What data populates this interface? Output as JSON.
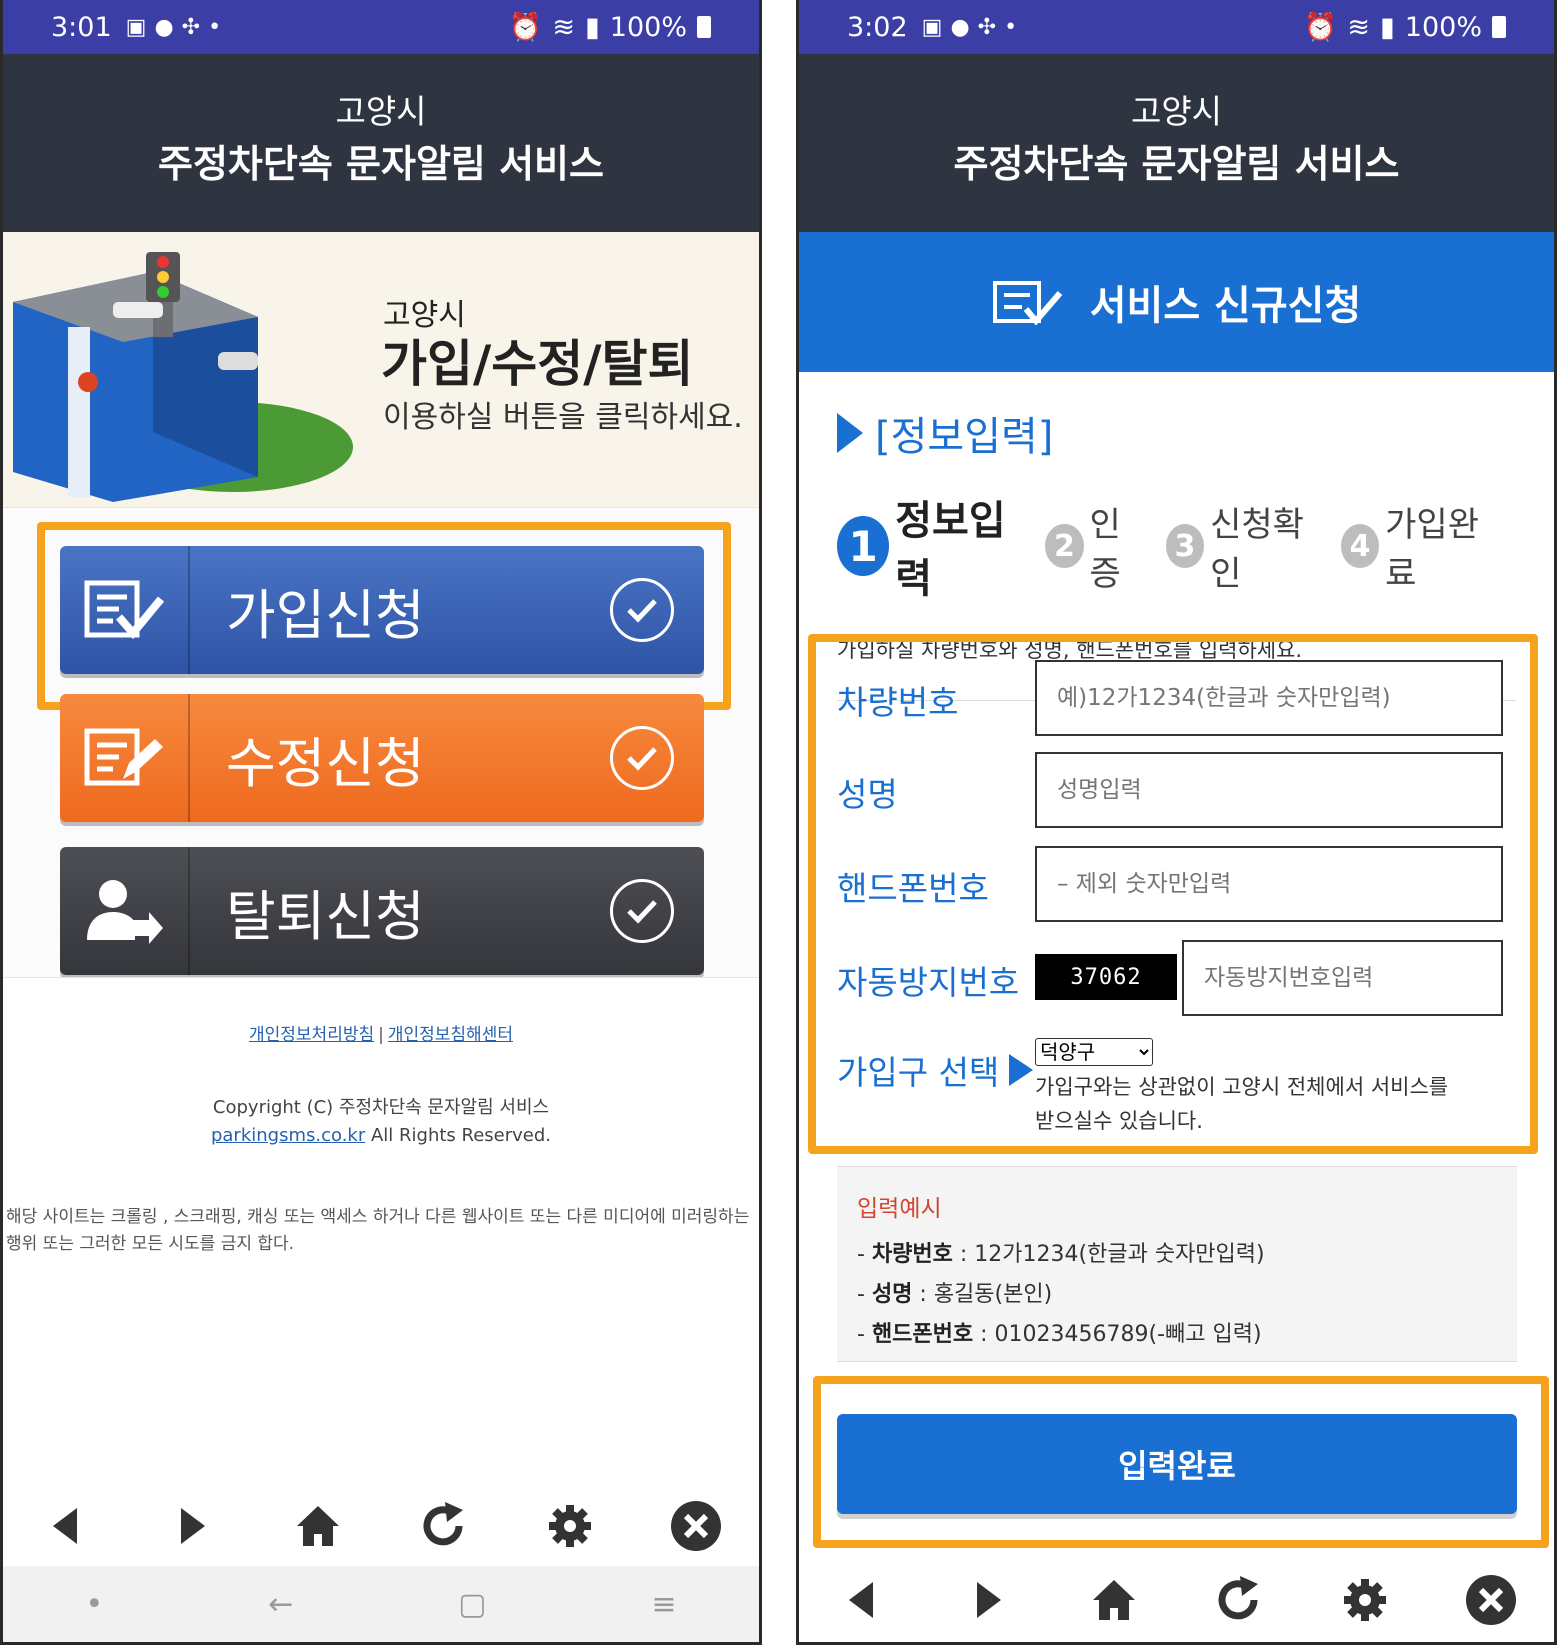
{
  "left": {
    "status": {
      "time": "3:01",
      "battery": "100%"
    },
    "header": {
      "city": "고양시",
      "service": "주정차단속 문자알림 서비스"
    },
    "banner": {
      "city": "고양시",
      "headline": "가입/수정/탈퇴",
      "sub": "이용하실 버튼을 클릭하세요."
    },
    "buttons": {
      "join": "가입신청",
      "edit": "수정신청",
      "leave": "탈퇴신청"
    },
    "footer": {
      "link_privacy": "개인정보처리방침",
      "link_sep": "|",
      "link_report": "개인정보침해센터",
      "copyright": "Copyright (C) 주정차단속 문자알림 서비스",
      "domain": "parkingsms.co.kr",
      "rights": "All Rights Reserved.",
      "notice": "해당 사이트는 크롤링 , 스크래핑, 캐싱 또는 액세스 하거나 다른 웹사이트 또는 다른 미디어에 미러링하는 행위 또는 그러한 모든 시도를 금지 합다."
    }
  },
  "right": {
    "status": {
      "time": "3:02",
      "battery": "100%"
    },
    "header": {
      "city": "고양시",
      "service": "주정차단속 문자알림 서비스"
    },
    "band_title": "서비스 신규신청",
    "section_title": "[정보입력]",
    "steps": [
      {
        "num": "1",
        "label": "정보입력"
      },
      {
        "num": "2",
        "label": "인증"
      },
      {
        "num": "3",
        "label": "신청확인"
      },
      {
        "num": "4",
        "label": "가입완료"
      }
    ],
    "guide": "가입하실 차량번호와 성명, 핸드폰번호를 입력하세요.",
    "form": {
      "car_label": "차량번호",
      "car_placeholder": "예)12가1234(한글과 숫자만입력)",
      "name_label": "성명",
      "name_placeholder": "성명입력",
      "phone_label": "핸드폰번호",
      "phone_placeholder": "– 제외 숫자만입력",
      "captcha_label": "자동방지번호",
      "captcha_code": "37062",
      "captcha_placeholder": "자동방지번호입력",
      "district_label": "가입구 선택",
      "district_value": "덕양구",
      "district_note": "가입구와는 상관없이 고양시 전체에서 서비스를 받으실수 있습니다."
    },
    "examples": {
      "title": "입력예시",
      "car_key": "차량번호",
      "car_val": " : 12가1234(한글과 숫자만입력)",
      "name_key": "성명",
      "name_val": " : 홍길동(본인)",
      "phone_key": "핸드폰번호",
      "phone_val": " : 01023456789(-빼고 입력)"
    },
    "submit": "입력완료"
  },
  "colors": {
    "primary_blue": "#1a6fd2",
    "header_dark": "#2f3540",
    "highlight": "#f7a21c",
    "orange": "#ee6a1e"
  }
}
